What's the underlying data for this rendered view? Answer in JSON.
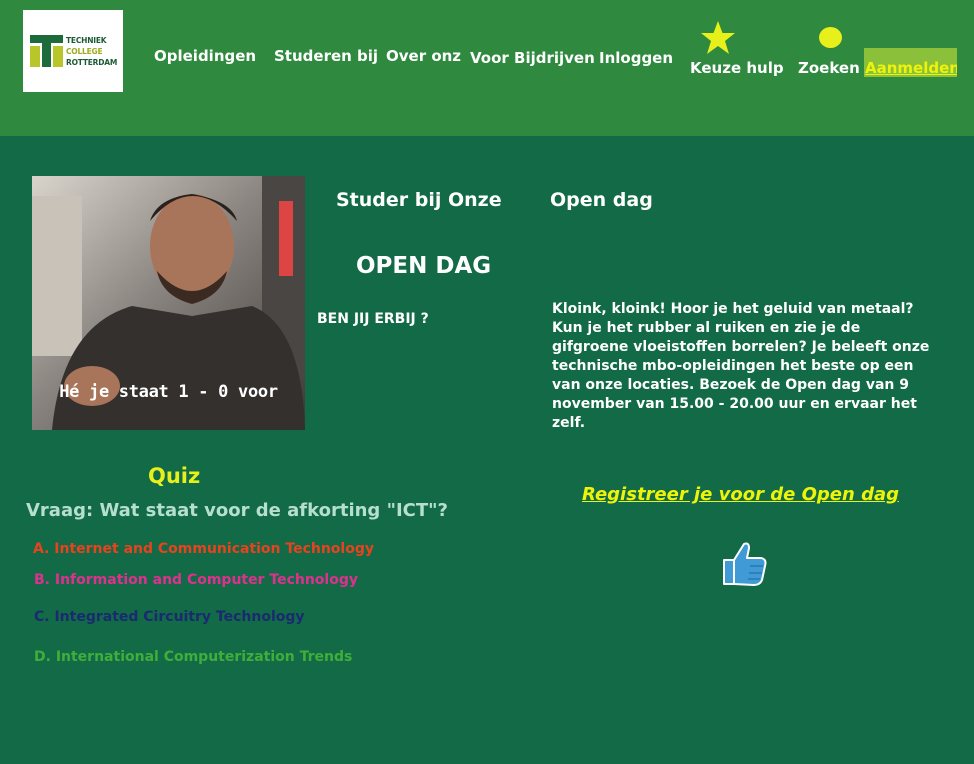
{
  "header": {
    "logo": {
      "line1": "TECHNIEK",
      "line2": "COLLEGE",
      "line3": "ROTTERDAM"
    },
    "nav": {
      "opleidingen": "Opleidingen",
      "studeren": "Studeren bij",
      "over": "Over onz",
      "bedrijven": "Voor Bijdrijven",
      "inloggen": "Inloggen",
      "keuzehulp": "Keuze hulp",
      "zoeken": "Zoeken",
      "aanmelden": "Aanmelden"
    },
    "icons": {
      "keuzehulp": "star-icon",
      "zoeken": "circle-icon"
    }
  },
  "hero": {
    "caption": "Hé je staat 1 - 0 voor"
  },
  "content": {
    "heading_left": "Studer bij Onze",
    "heading_right": "Open dag",
    "open_dag_title": "OPEN DAG",
    "ben_jij": "BEN JIJ ERBIJ ?",
    "body": "Kloink, kloink! Hoor je het geluid van metaal? Kun je het rubber al ruiken en zie je de gifgroene vloeistoffen borrelen? Je beleeft onze technische mbo-opleidingen het beste op een van onze locaties. Bezoek de Open dag van 9 november van 15.00 - 20.00 uur en ervaar het zelf.",
    "register_link": "Registreer je voor de Open dag",
    "thumb_icon": "thumbs-up-icon"
  },
  "quiz": {
    "title": "Quiz",
    "question": "Vraag: Wat staat voor de afkorting \"ICT\"?",
    "answers": [
      {
        "label": "A. Internet and Communication Technology",
        "color": "#e8421f"
      },
      {
        "label": "B. Information and Computer Technology",
        "color": "#e0308f"
      },
      {
        "label": "C. Integrated Circuitry Technology",
        "color": "#1a2a70"
      },
      {
        "label": "D. International Computerization Trends",
        "color": "#3fae3a"
      }
    ]
  },
  "colors": {
    "page_bg": "#126b46",
    "header_bg": "#2f8a3f",
    "accent_yellow": "#eef30a",
    "register_bg": "#8bc03a"
  }
}
